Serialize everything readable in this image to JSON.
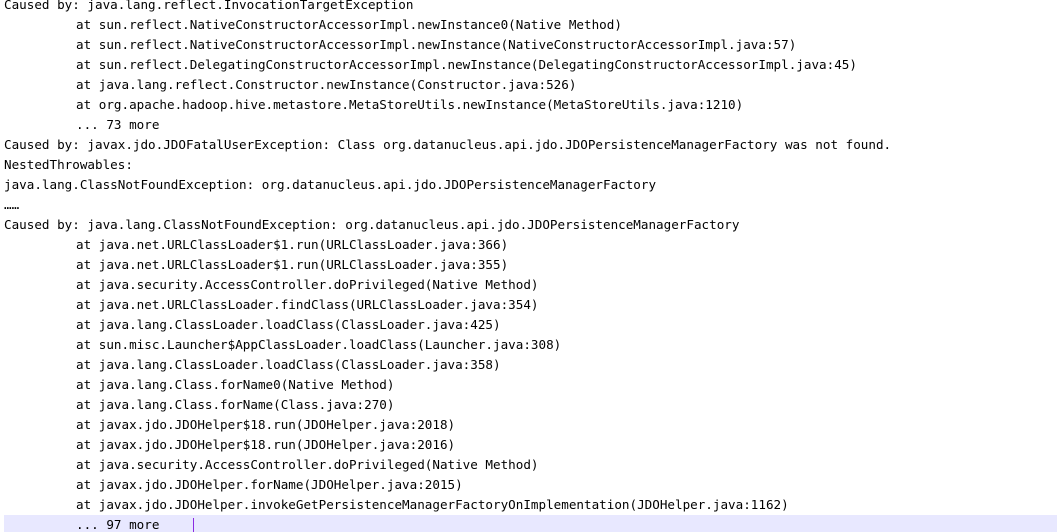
{
  "editor": {
    "lines": [
      {
        "text": "Caused by: java.lang.reflect.InvocationTargetException",
        "indent": false
      },
      {
        "text": "at sun.reflect.NativeConstructorAccessorImpl.newInstance0(Native Method)",
        "indent": true
      },
      {
        "text": "at sun.reflect.NativeConstructorAccessorImpl.newInstance(NativeConstructorAccessorImpl.java:57)",
        "indent": true
      },
      {
        "text": "at sun.reflect.DelegatingConstructorAccessorImpl.newInstance(DelegatingConstructorAccessorImpl.java:45)",
        "indent": true
      },
      {
        "text": "at java.lang.reflect.Constructor.newInstance(Constructor.java:526)",
        "indent": true
      },
      {
        "text": "at org.apache.hadoop.hive.metastore.MetaStoreUtils.newInstance(MetaStoreUtils.java:1210)",
        "indent": true
      },
      {
        "text": "... 73 more",
        "indent": true
      },
      {
        "text": "Caused by: javax.jdo.JDOFatalUserException: Class org.datanucleus.api.jdo.JDOPersistenceManagerFactory was not found.",
        "indent": false
      },
      {
        "text": "NestedThrowables:",
        "indent": false
      },
      {
        "text": "java.lang.ClassNotFoundException: org.datanucleus.api.jdo.JDOPersistenceManagerFactory",
        "indent": false
      },
      {
        "text": "……",
        "indent": false
      },
      {
        "text": "Caused by: java.lang.ClassNotFoundException: org.datanucleus.api.jdo.JDOPersistenceManagerFactory",
        "indent": false
      },
      {
        "text": "at java.net.URLClassLoader$1.run(URLClassLoader.java:366)",
        "indent": true
      },
      {
        "text": "at java.net.URLClassLoader$1.run(URLClassLoader.java:355)",
        "indent": true
      },
      {
        "text": "at java.security.AccessController.doPrivileged(Native Method)",
        "indent": true
      },
      {
        "text": "at java.net.URLClassLoader.findClass(URLClassLoader.java:354)",
        "indent": true
      },
      {
        "text": "at java.lang.ClassLoader.loadClass(ClassLoader.java:425)",
        "indent": true
      },
      {
        "text": "at sun.misc.Launcher$AppClassLoader.loadClass(Launcher.java:308)",
        "indent": true
      },
      {
        "text": "at java.lang.ClassLoader.loadClass(ClassLoader.java:358)",
        "indent": true
      },
      {
        "text": "at java.lang.Class.forName0(Native Method)",
        "indent": true
      },
      {
        "text": "at java.lang.Class.forName(Class.java:270)",
        "indent": true
      },
      {
        "text": "at javax.jdo.JDOHelper$18.run(JDOHelper.java:2018)",
        "indent": true
      },
      {
        "text": "at javax.jdo.JDOHelper$18.run(JDOHelper.java:2016)",
        "indent": true
      },
      {
        "text": "at java.security.AccessController.doPrivileged(Native Method)",
        "indent": true
      },
      {
        "text": "at javax.jdo.JDOHelper.forName(JDOHelper.java:2015)",
        "indent": true
      },
      {
        "text": "at javax.jdo.JDOHelper.invokeGetPersistenceManagerFactoryOnImplementation(JDOHelper.java:1162)",
        "indent": true
      },
      {
        "text": "... 97 more",
        "indent": true,
        "current": true
      }
    ]
  },
  "colors": {
    "text": "#000000",
    "background": "#ffffff",
    "current_line": "#e8e8ff",
    "caret": "#8a2be2"
  }
}
